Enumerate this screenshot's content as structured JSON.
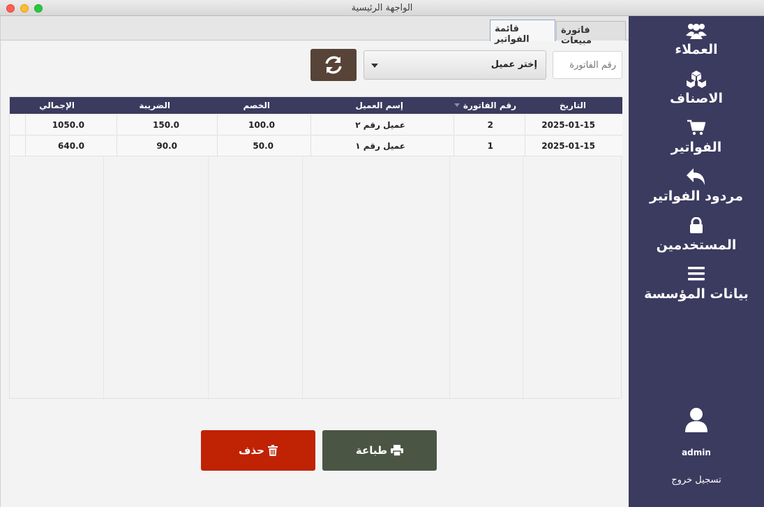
{
  "window": {
    "title": "الواجهة الرئيسية"
  },
  "sidebar": {
    "items": [
      {
        "label": "العملاء",
        "icon": "users-icon"
      },
      {
        "label": "الاصناف",
        "icon": "cubes-icon"
      },
      {
        "label": "الفواتير",
        "icon": "cart-icon"
      },
      {
        "label": "مردود الفواتير",
        "icon": "reply-icon"
      },
      {
        "label": "المستخدمين",
        "icon": "lock-icon"
      },
      {
        "label": "بيانات المؤسسة",
        "icon": "bars-icon"
      }
    ],
    "user": {
      "name": "admin",
      "logout_label": "تسجيل خروج",
      "icon": "user-icon"
    }
  },
  "tabs": [
    {
      "label": "فاتورة مبيعات",
      "active": false
    },
    {
      "label": "قائمة الفواتير",
      "active": true
    }
  ],
  "toolbar": {
    "invoice_number_placeholder": "رقم الفاتورة",
    "client_select_value": "إختر عميل",
    "refresh_icon": "refresh-icon"
  },
  "table": {
    "columns": [
      "التاريخ",
      "رقم الفاتورة",
      "إسم العميل",
      "الخصم",
      "الضريبة",
      "الإجمالي"
    ],
    "rows": [
      {
        "date": "2025-01-15",
        "invoice_no": "2",
        "client": "عميل رقم ٢",
        "discount": "100.0",
        "tax": "150.0",
        "total": "1050.0"
      },
      {
        "date": "2025-01-15",
        "invoice_no": "1",
        "client": "عميل رقم ١",
        "discount": "50.0",
        "tax": "90.0",
        "total": "640.0"
      }
    ]
  },
  "actions": {
    "print_label": "طباعة",
    "delete_label": "حذف"
  },
  "colors": {
    "sidebar": "#3b3a5f",
    "refresh_button": "#574337",
    "print_button": "#4b5543",
    "delete_button": "#c02204"
  }
}
